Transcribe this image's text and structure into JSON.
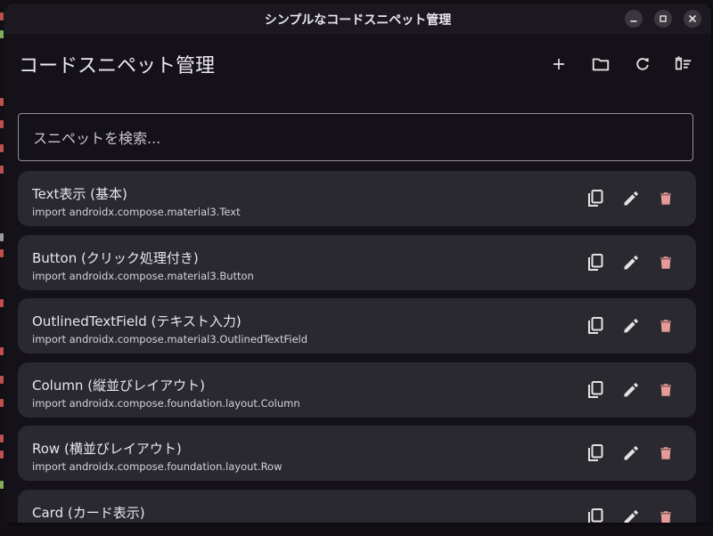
{
  "window": {
    "title": "シンプルなコードスニペット管理"
  },
  "appbar": {
    "title": "コードスニペット管理",
    "actions": [
      "add-icon",
      "folder-icon",
      "refresh-icon",
      "clear-all-icon"
    ]
  },
  "search": {
    "placeholder": "スニペットを検索..."
  },
  "snippets": [
    {
      "title": "Text表示 (基本)",
      "subtitle": "import androidx.compose.material3.Text"
    },
    {
      "title": "Button (クリック処理付き)",
      "subtitle": "import androidx.compose.material3.Button"
    },
    {
      "title": "OutlinedTextField (テキスト入力)",
      "subtitle": "import androidx.compose.material3.OutlinedTextField"
    },
    {
      "title": "Column (縦並びレイアウト)",
      "subtitle": "import androidx.compose.foundation.layout.Column"
    },
    {
      "title": "Row (横並びレイアウト)",
      "subtitle": "import androidx.compose.foundation.layout.Row"
    },
    {
      "title": "Card (カード表示)",
      "subtitle": ""
    }
  ],
  "colors": {
    "background": "#141218",
    "card": "#2b2930",
    "delete_icon": "#e79a9a",
    "icon": "#e6e1e5"
  }
}
